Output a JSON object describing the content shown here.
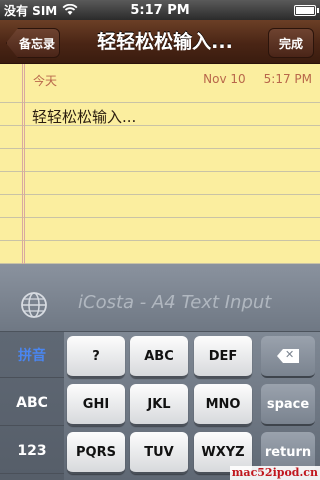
{
  "status_bar": {
    "carrier": "没有 SIM",
    "time": "5:17 PM"
  },
  "nav": {
    "back_label": "备忘录",
    "title": "轻轻松松输入...",
    "done_label": "完成"
  },
  "note": {
    "day": "今天",
    "date": "Nov 10",
    "time": "5:17 PM",
    "body": "轻轻松松输入..."
  },
  "keyboard": {
    "banner": "iCosta - A4 Text Input",
    "modes": [
      "拼音",
      "ABC",
      "123"
    ],
    "active_mode": "拼音",
    "rows": [
      [
        "?",
        "ABC",
        "DEF"
      ],
      [
        "GHI",
        "JKL",
        "MNO"
      ],
      [
        "PQRS",
        "TUV",
        "WXYZ"
      ]
    ],
    "space_label": "space",
    "return_label": "return"
  },
  "watermark": "mac52ipod.cn",
  "colors": {
    "nav_leather": "#4a2515",
    "note_paper": "#fbee9f",
    "date_text": "#b8674b",
    "active_mode": "#4a86f0",
    "watermark": "#c0161d"
  }
}
